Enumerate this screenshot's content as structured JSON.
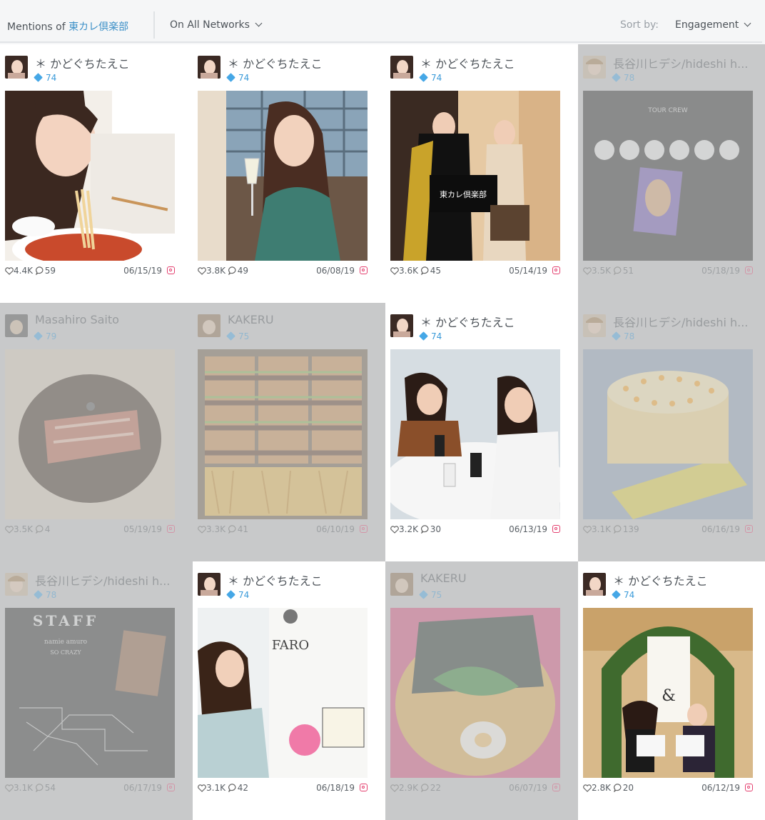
{
  "header": {
    "mentions_prefix": "Mentions of",
    "mentions_brand": "東カレ倶楽部",
    "networks_label": "On All Networks",
    "sort_label": "Sort by:",
    "sort_value": "Engagement"
  },
  "colors": {
    "brand_blue": "#3a8fc7",
    "score_blue": "#45a7e6",
    "instagram_pink": "#e4406f",
    "faded_card": "#c8c9ca"
  },
  "posts": [
    {
      "author": "＊ かどぐちたえこ",
      "score": "74",
      "likes": "4.4K",
      "comments": "59",
      "date": "06/15/19",
      "network": "instagram-icon",
      "faded": false
    },
    {
      "author": "＊ かどぐちたえこ",
      "score": "74",
      "likes": "3.8K",
      "comments": "49",
      "date": "06/08/19",
      "network": "instagram-icon",
      "faded": false
    },
    {
      "author": "＊ かどぐちたえこ",
      "score": "74",
      "likes": "3.6K",
      "comments": "45",
      "date": "05/14/19",
      "network": "instagram-icon",
      "faded": false
    },
    {
      "author": "長谷川ヒデシ/hideshi h...",
      "score": "78",
      "likes": "3.5K",
      "comments": "51",
      "date": "05/18/19",
      "network": "instagram-icon",
      "faded": true
    },
    {
      "author": "Masahiro Saito",
      "score": "79",
      "likes": "3.5K",
      "comments": "4",
      "date": "05/19/19",
      "network": "instagram-icon",
      "faded": true
    },
    {
      "author": "KAKERU",
      "score": "75",
      "likes": "3.3K",
      "comments": "41",
      "date": "06/10/19",
      "network": "instagram-icon",
      "faded": true
    },
    {
      "author": "＊ かどぐちたえこ",
      "score": "74",
      "likes": "3.2K",
      "comments": "30",
      "date": "06/13/19",
      "network": "instagram-icon",
      "faded": false
    },
    {
      "author": "長谷川ヒデシ/hideshi h...",
      "score": "78",
      "likes": "3.1K",
      "comments": "139",
      "date": "06/16/19",
      "network": "instagram-icon",
      "faded": true
    },
    {
      "author": "長谷川ヒデシ/hideshi h...",
      "score": "78",
      "likes": "3.1K",
      "comments": "54",
      "date": "06/17/19",
      "network": "instagram-icon",
      "faded": true
    },
    {
      "author": "＊ かどぐちたえこ",
      "score": "74",
      "likes": "3.1K",
      "comments": "42",
      "date": "06/18/19",
      "network": "instagram-icon",
      "faded": false
    },
    {
      "author": "KAKERU",
      "score": "75",
      "likes": "2.9K",
      "comments": "22",
      "date": "06/07/19",
      "network": "instagram-icon",
      "faded": true
    },
    {
      "author": "＊ かどぐちたえこ",
      "score": "74",
      "likes": "2.8K",
      "comments": "20",
      "date": "06/12/19",
      "network": "instagram-icon",
      "faded": false
    }
  ],
  "photo_text": {
    "club_sign": "東カレ倶楽部",
    "tour_crew": "TOUR CREW",
    "staff": "STAFF",
    "namie": "namie amuro",
    "so_crazy": "SO CRAZY",
    "faro": "FARO",
    "amp": "&"
  }
}
